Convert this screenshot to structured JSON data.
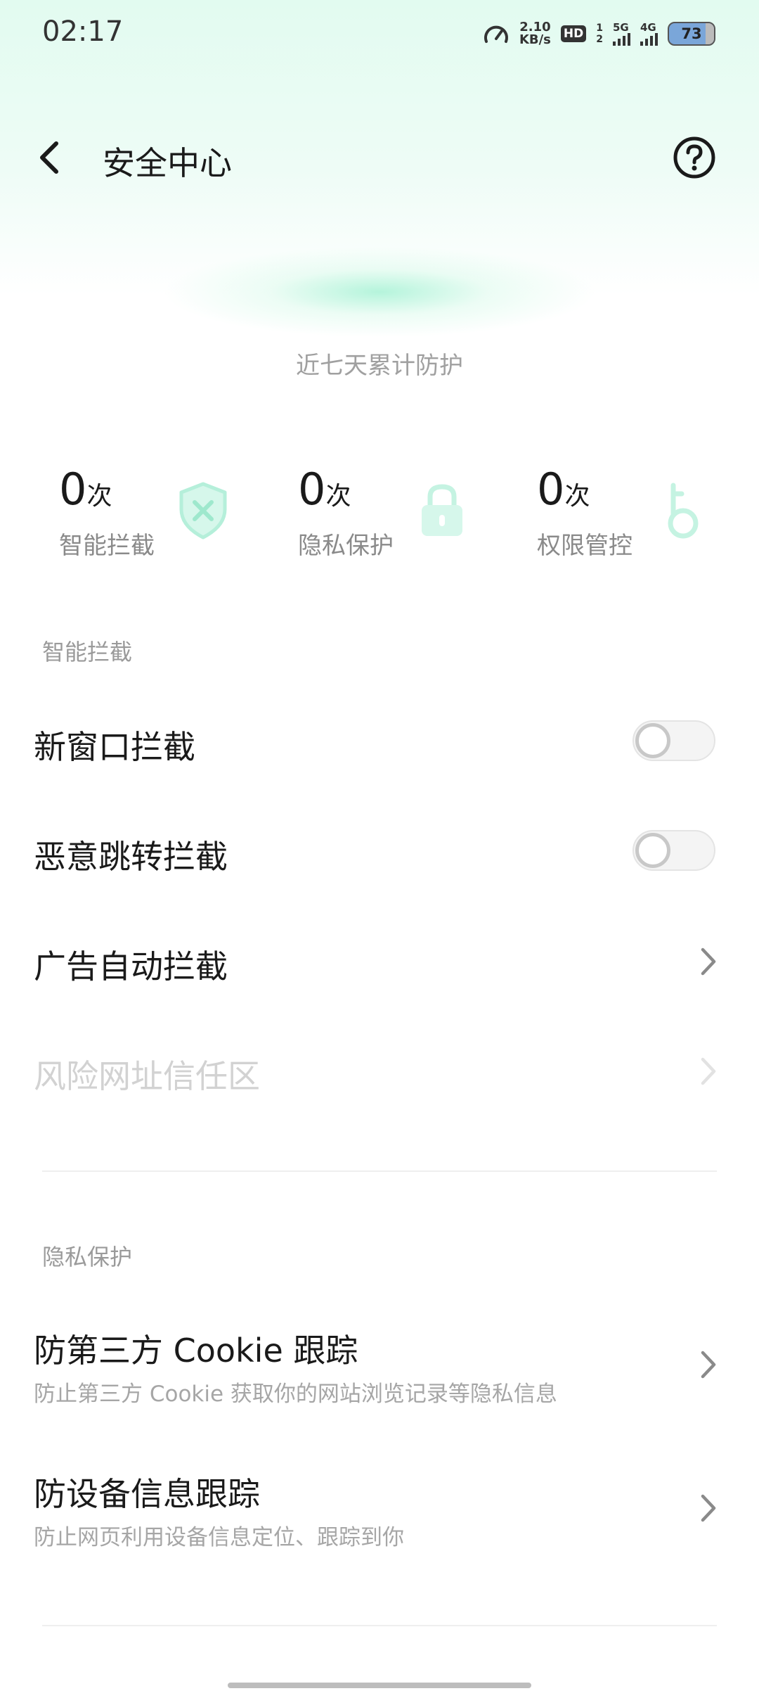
{
  "status_bar": {
    "time": "02:17",
    "speed_value": "2.10",
    "speed_unit": "KB/s",
    "hd_label": "HD",
    "sim_slot_top": "1",
    "sim_slot_bottom": "2",
    "network_1": "5G",
    "network_2": "4G",
    "battery_level": "73"
  },
  "header": {
    "title": "安全中心"
  },
  "summary": {
    "caption": "近七天累计防护",
    "stats": [
      {
        "count": "0",
        "unit": "次",
        "label": "智能拦截",
        "icon": "shield-x-icon"
      },
      {
        "count": "0",
        "unit": "次",
        "label": "隐私保护",
        "icon": "lock-icon"
      },
      {
        "count": "0",
        "unit": "次",
        "label": "权限管控",
        "icon": "key-icon"
      }
    ]
  },
  "smart_block": {
    "heading": "智能拦截",
    "items": [
      {
        "label": "新窗口拦截",
        "control": "toggle",
        "enabled": false
      },
      {
        "label": "恶意跳转拦截",
        "control": "toggle",
        "enabled": false
      },
      {
        "label": "广告自动拦截",
        "control": "chevron"
      },
      {
        "label": "风险网址信任区",
        "control": "chevron",
        "disabled": true
      }
    ]
  },
  "privacy": {
    "heading": "隐私保护",
    "items": [
      {
        "label": "防第三方 Cookie 跟踪",
        "description": "防止第三方 Cookie 获取你的网站浏览记录等隐私信息"
      },
      {
        "label": "防设备信息跟踪",
        "description": "防止网页利用设备信息定位、跟踪到你"
      }
    ]
  },
  "colors": {
    "accent_mint": "#8ff0cf",
    "header_gradient": "#e2fbf0",
    "text_primary": "#1a1a1a",
    "text_secondary": "#a0a0a0"
  }
}
